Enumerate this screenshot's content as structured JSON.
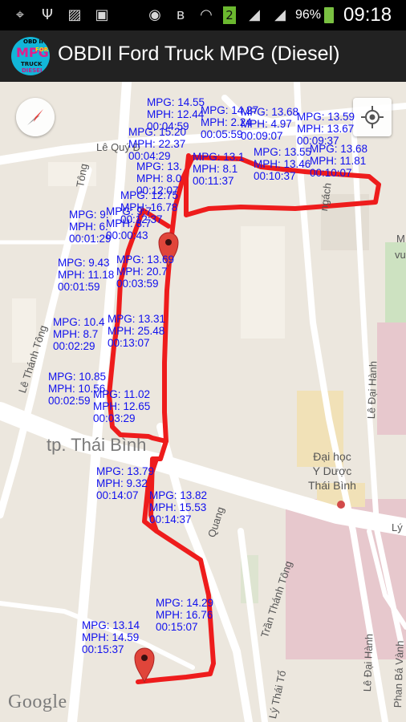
{
  "status_bar": {
    "battery": "96%",
    "time": "09:18",
    "sim_badge": "2",
    "icons": [
      "location-icon",
      "usb-icon",
      "image-icon",
      "briefcase-icon",
      "eye-icon",
      "bluetooth-icon",
      "wifi-icon",
      "signal-icon",
      "battery-icon"
    ]
  },
  "app_bar": {
    "title": "OBDII Ford Truck MPG (Diesel)",
    "logo_text": [
      "OBD II",
      "MPG",
      "FORD",
      "TRUCK",
      "DIESEL"
    ]
  },
  "map": {
    "route_color": "#ee1c1c",
    "tag_color": "#1010ee",
    "attribution": "Google",
    "city": "tp. Thái Bình",
    "place": [
      "Đại học",
      "Y Dược",
      "Thái Bình"
    ],
    "streets": {
      "le_quoc": "Lê Quý Đ",
      "tong_top": "Tông",
      "thanh_tong_left": "Lê Thánh Tông",
      "ngach": "ngách",
      "le_dai_hanh_top": "Lê Đại Hành",
      "le_dai_hanh_bottom": "Lê Đại Hành",
      "quang_trung": "Quang",
      "tran_thanh_tong": "Trần Thánh Tông",
      "ly_thai_to": "Lý Thái Tổ",
      "phan_ba_vanh": "Phan Bá Vành",
      "ly_right": "Lý",
      "m_right": "M",
      "vu_right": "vu"
    },
    "tags": [
      {
        "lines": [
          "MPG: 14.55",
          "MPH: 12.44",
          "00:04:59"
        ]
      },
      {
        "lines": [
          "MPG: 14.27",
          "MPH: 2.24",
          "00:05:59"
        ]
      },
      {
        "lines": [
          "MPG: 13.68",
          "MPH: 4.97",
          "00:09:07"
        ]
      },
      {
        "lines": [
          "MPG: 13.59",
          "MPH: 13.67",
          "00:09:37"
        ]
      },
      {
        "lines": [
          "MPG: 15.20",
          "MPH: 22.37",
          "00:04:29"
        ]
      },
      {
        "lines": [
          "MPG: 13.68",
          "MPH: 11.81",
          "00:10:07"
        ]
      },
      {
        "lines": [
          "MPG: 13.",
          "MPH: 8.0",
          "00:12:07"
        ]
      },
      {
        "lines": [
          "MPG: 13.1",
          "MPH: 8.1",
          "00:11:37"
        ]
      },
      {
        "lines": [
          "MPG: 13.55",
          "MPH: 13.46",
          "00:10:37"
        ]
      },
      {
        "lines": [
          "MPG: 12.75",
          "MPH: 16.78",
          "00:12:37"
        ]
      },
      {
        "lines": [
          "MPG: 9.",
          "MPH: 6.",
          "00:01:29"
        ]
      },
      {
        "lines": [
          "MPG: 9.7",
          "MPH: 8.7",
          "00:00:43"
        ]
      },
      {
        "lines": [
          "MPG: 9.43",
          "MPH: 11.18",
          "00:01:59"
        ]
      },
      {
        "lines": [
          "MPG: 13.69",
          "MPH: 20.7",
          "00:03:59"
        ]
      },
      {
        "lines": [
          "MPG: 10.4",
          "MPH: 8.7",
          "00:02:29"
        ]
      },
      {
        "lines": [
          "MPG: 13.31",
          "MPH: 25.48",
          "00:13:07"
        ]
      },
      {
        "lines": [
          "MPG: 10.85",
          "MPH: 10.56",
          "00:02:59"
        ]
      },
      {
        "lines": [
          "MPG: 11.02",
          "MPH: 12.65",
          "00:03:29"
        ]
      },
      {
        "lines": [
          "MPG: 13.79",
          "MPH: 9.32",
          "00:14:07"
        ]
      },
      {
        "lines": [
          "MPG: 13.82",
          "MPH: 15.53",
          "00:14:37"
        ]
      },
      {
        "lines": [
          "MPG: 14.29",
          "MPH: 16.76",
          "00:15:07"
        ]
      },
      {
        "lines": [
          "MPG: 13.14",
          "MPH: 14.59",
          "00:15:37"
        ]
      }
    ]
  }
}
